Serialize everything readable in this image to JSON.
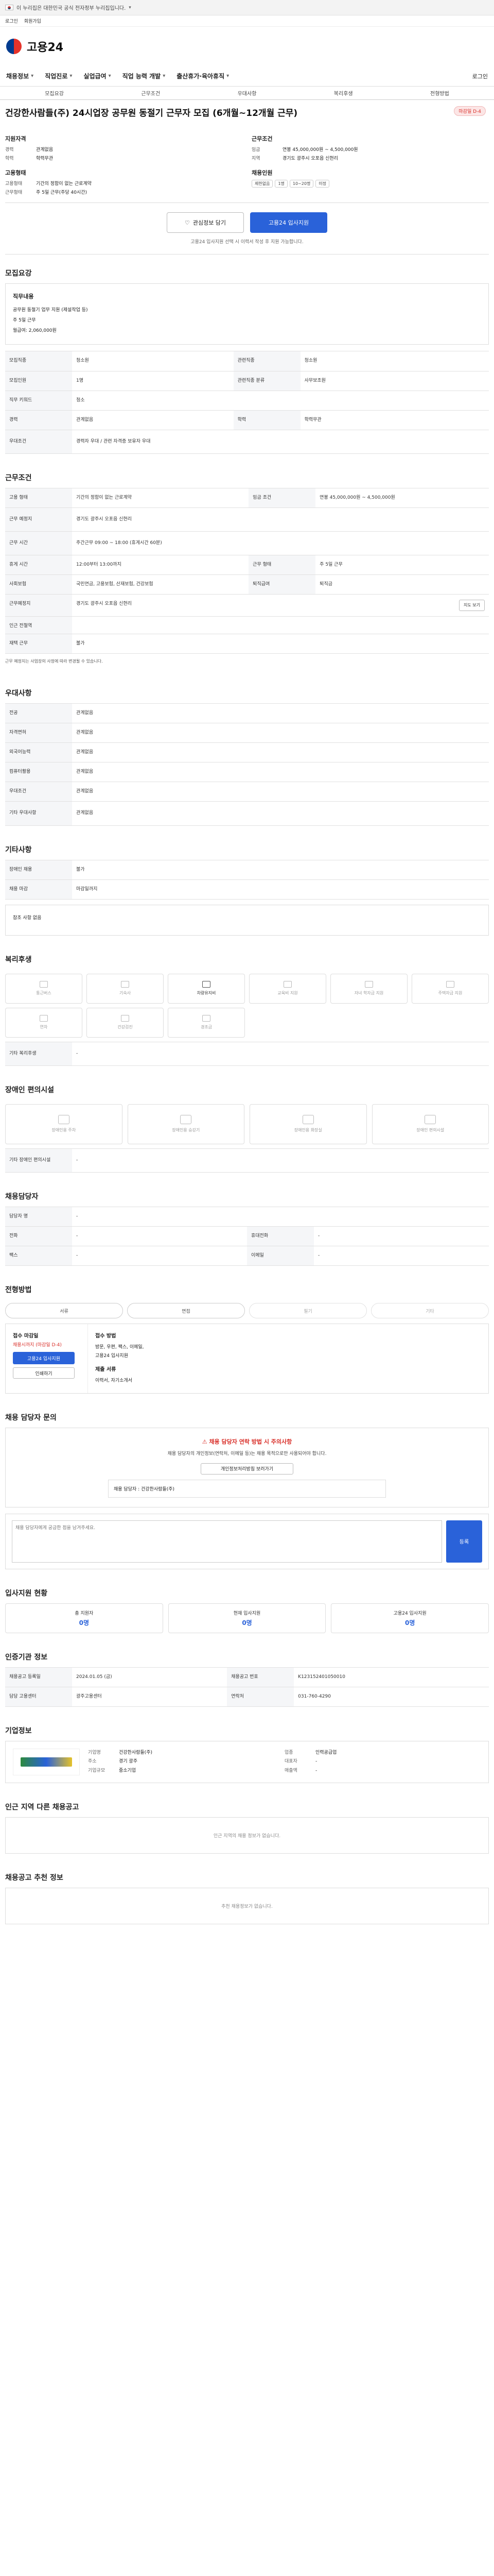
{
  "gov_bar": {
    "text": "이 누리집은 대한민국 공식 전자정부 누리집입니다."
  },
  "util": {
    "items": [
      "로그인",
      "회원가입"
    ]
  },
  "brand": {
    "name": "고용24"
  },
  "gnb": {
    "items": [
      "채용정보",
      "직업진로",
      "실업급여",
      "직업 능력 개발",
      "출산휴가·육아휴직"
    ],
    "login": "로그인"
  },
  "tabs": [
    "모집요강",
    "근무조건",
    "우대사항",
    "복리후생",
    "전형방법"
  ],
  "job": {
    "title": "건강한사람들(주) 24시업장 공무원 동절기 근무자 모집 (6개월~12개월 근무)",
    "status_badge": "마감일 D-4"
  },
  "summary": {
    "col1": {
      "h1": "지원자격",
      "rows": [
        [
          "경력",
          "관계없음"
        ],
        [
          "학력",
          "학력무관"
        ]
      ],
      "h2": "고용형태",
      "rows2": [
        [
          "고용형태",
          "기간의 정함이 없는 근로계약"
        ],
        [
          "근무형태",
          "주 5일 근무(주당 40시간)"
        ]
      ]
    },
    "col2": {
      "h1": "근무조건",
      "rows": [
        [
          "임금",
          "연봉 45,000,000원 ~ 4,500,000원"
        ],
        [
          "지역",
          "경기도 광주시 오포읍 신현리"
        ]
      ],
      "h2": "채용인원",
      "chips": [
        "제한없음",
        "1명",
        "10~20명",
        "미정"
      ]
    }
  },
  "actions": {
    "scrap": "관심정보 담기",
    "apply": "고용24 입사지원"
  },
  "action_note": "고용24 입사지원 선택 시 이력서 작성 후 지원 가능합니다.",
  "recruit": {
    "section": "모집요강",
    "box_title": "직무내용",
    "lines": [
      "공무원 동절기 업무 지원 (제설작업 등)",
      "주 5일 근무",
      "월급여: 2,060,000원"
    ],
    "rows": [
      [
        "모집직종",
        "청소원",
        "관련직종",
        "청소원"
      ],
      [
        "모집인원",
        "1명",
        "관련직종 분류",
        "사무보조원"
      ],
      [
        "직무 키워드",
        "청소"
      ],
      [
        "경력",
        "관계없음",
        "학력",
        "학력무관"
      ],
      [
        "우대조건",
        "경력자 우대 / 관련 자격증 보유자 우대"
      ]
    ]
  },
  "work": {
    "section": "근무조건",
    "rows": [
      [
        "고용 형태",
        "기간의 정함이 없는 근로계약",
        "임금 조건",
        "연봉 45,000,000원 ~ 4,500,000원"
      ],
      [
        "근무 예정지",
        "경기도 광주시 오포읍 신현리"
      ],
      [
        "근무 시간",
        "주간근무 09:00 ~ 18:00 (휴게시간 60분)"
      ],
      [
        "휴게 시간",
        "12:00부터 13:00까지",
        "근무 형태",
        "주 5일 근무"
      ],
      [
        "사회보험",
        "국민연금, 고용보험, 산재보험, 건강보험",
        "퇴직급여",
        "퇴직금"
      ],
      [
        "근무예정지",
        "경기도 광주시 오포읍 신현리"
      ],
      [
        "인근 전철역",
        ""
      ],
      [
        "재택 근무",
        "불가"
      ]
    ],
    "map_btn": "지도 보기",
    "note": "근무 예정지는 사업장의 사정에 따라 변경될 수 있습니다."
  },
  "prefer": {
    "section": "우대사항",
    "rows": [
      [
        "전공",
        "관계없음"
      ],
      [
        "자격면허",
        "관계없음"
      ],
      [
        "외국어능력",
        "관계없음"
      ],
      [
        "컴퓨터활용",
        "관계없음"
      ],
      [
        "우대조건",
        "관계없음"
      ],
      [
        "기타 우대사항",
        "관계없음"
      ]
    ]
  },
  "etc": {
    "section": "기타사항",
    "rows": [
      [
        "장애인 채용",
        "불가"
      ],
      [
        "채용 마감",
        "마감일까지"
      ]
    ],
    "box": "참조 사항 없음"
  },
  "welfare": {
    "section": "복리후생",
    "items": [
      [
        "통근버스",
        false
      ],
      [
        "기숙사",
        false
      ],
      [
        "차량유지비",
        true
      ],
      [
        "교육비 지원",
        false
      ],
      [
        "자녀 학자금 지원",
        false
      ],
      [
        "주택자금 지원",
        false
      ],
      [
        "연차",
        false
      ],
      [
        "건강검진",
        false
      ],
      [
        "경조금",
        false
      ]
    ],
    "other_label": "기타 복리후생",
    "other_value": "-"
  },
  "disabled": {
    "section": "장애인 편의시설",
    "items": [
      "장애인용 주차",
      "장애인용 승강기",
      "장애인용 화장실",
      "장애인 편의시설"
    ],
    "other_label": "기타 장애인 편의시설",
    "other_value": "-"
  },
  "contact": {
    "section": "채용담당자",
    "rows": [
      [
        "담당자 명",
        "-"
      ],
      [
        "전화",
        "-",
        "휴대전화",
        "-"
      ],
      [
        "팩스",
        "-",
        "이메일",
        "-"
      ]
    ]
  },
  "selection": {
    "section": "전형방법",
    "steps": [
      "서류",
      "면접",
      "필기",
      "기타"
    ],
    "apply_h": "접수 마감일",
    "deadline": "채용시까지 (마감일 D-4)",
    "apply_btn": "고용24 입사지원",
    "print_btn": "인쇄하기",
    "methods_h": "접수 방법",
    "methods": [
      "방문, 우편, 팩스, 이메일,",
      "고용24 입사지원"
    ],
    "docs_h": "제출 서류",
    "docs": "이력서, 자기소개서"
  },
  "qna": {
    "section": "채용 담당자 문의",
    "warn": "채용 담당자 연락 방법 시 주의사항",
    "warn_text": "채용 담당자의 개인정보(연락처, 이메일 등)는 채용 목적으로만 사용되어야 합니다.",
    "button": "개인정보처리방침 보러가기",
    "in_label": "채용 담당자",
    "in_name": "건강한사람들(주)",
    "placeholder": "채용 담당자에게 궁금한 점을 남겨주세요.",
    "send": "등록"
  },
  "stats": {
    "section": "입사지원 현황",
    "items": [
      [
        "총 지원자",
        "0명"
      ],
      [
        "현재 입사지원",
        "0명"
      ],
      [
        "고용24 입사지원",
        "0명"
      ]
    ]
  },
  "reg": {
    "section": "인증기관 정보",
    "rows": [
      [
        "채용공고 등록일",
        "2024.01.05 (금)",
        "채용공고 번호",
        "K123152401050010"
      ],
      [
        "담당 고용센터",
        "광주고용센터",
        "연락처",
        "031-760-4290"
      ]
    ]
  },
  "company": {
    "section": "기업정보",
    "rows": [
      [
        "기업명",
        "건강한사람들(주)",
        "업종",
        "인력공급업"
      ],
      [
        "주소",
        "경기 광주",
        "대표자",
        "-"
      ],
      [
        "기업규모",
        "중소기업",
        "매출액",
        "-"
      ]
    ]
  },
  "other_jobs": {
    "section": "인근 지역 다른 채용공고",
    "empty": "인근 지역의 채용 정보가 없습니다."
  },
  "similar": {
    "section": "채용공고 추천 정보",
    "empty": "추천 채용정보가 없습니다."
  }
}
